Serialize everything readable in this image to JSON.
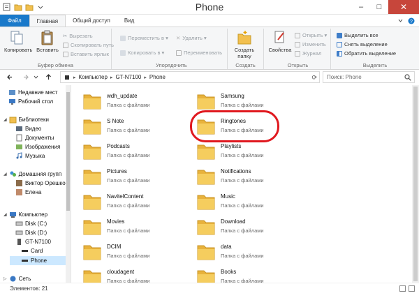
{
  "window": {
    "title": "Phone",
    "controls": {
      "minimize": "–",
      "maximize": "□",
      "close": "✕"
    }
  },
  "ribbon_tabs": [
    {
      "label": "Файл"
    },
    {
      "label": "Главная"
    },
    {
      "label": "Общий доступ"
    },
    {
      "label": "Вид"
    }
  ],
  "ribbon": {
    "clipboard": {
      "group_label": "Буфер обмена",
      "copy": "Копировать",
      "paste": "Вставить",
      "cut": "Вырезать",
      "copy_path": "Скопировать путь",
      "paste_shortcut": "Вставить ярлык"
    },
    "organize": {
      "group_label": "Упорядочить",
      "move_to": "Переместить в ▾",
      "copy_to": "Копировать в ▾",
      "delete": "Удалить ▾",
      "rename": "Переименовать"
    },
    "new": {
      "group_label": "Создать",
      "new_folder_line1": "Создать",
      "new_folder_line2": "папку"
    },
    "open": {
      "group_label": "Открыть",
      "properties": "Свойства",
      "open": "Открыть ▾",
      "edit": "Изменить",
      "history": "Журнал"
    },
    "select": {
      "group_label": "Выделить",
      "select_all": "Выделить все",
      "select_none": "Снять выделение",
      "invert": "Обратить выделение"
    }
  },
  "address": {
    "crumbs": [
      "Компьютер",
      "GT-N7100",
      "Phone"
    ],
    "search_placeholder": "Поиск: Phone"
  },
  "nav": {
    "items": [
      {
        "label": "Недавние мест",
        "icon": "recent-places-icon"
      },
      {
        "label": "Рабочий стол",
        "icon": "desktop-icon"
      },
      {
        "label": "Библиотеки",
        "icon": "libraries-icon"
      },
      {
        "label": "Видео",
        "icon": "video-icon"
      },
      {
        "label": "Документы",
        "icon": "documents-icon"
      },
      {
        "label": "Изображения",
        "icon": "pictures-icon"
      },
      {
        "label": "Музыка",
        "icon": "music-icon"
      },
      {
        "label": "Домашняя групп",
        "icon": "homegroup-icon"
      },
      {
        "label": "Виктор Орешко",
        "icon": "user-icon"
      },
      {
        "label": "Елена",
        "icon": "user-icon"
      },
      {
        "label": "Компьютер",
        "icon": "computer-icon"
      },
      {
        "label": "Disk (C:)",
        "icon": "drive-icon"
      },
      {
        "label": "Disk (D:)",
        "icon": "drive-icon"
      },
      {
        "label": "GT-N7100",
        "icon": "phone-icon"
      },
      {
        "label": "Card",
        "icon": "card-icon"
      },
      {
        "label": "Phone",
        "icon": "phone-storage-icon"
      },
      {
        "label": "Сеть",
        "icon": "network-icon"
      }
    ]
  },
  "folders": [
    {
      "name": "wdh_update",
      "type": "Папка с файлами"
    },
    {
      "name": "Samsung",
      "type": "Папка с файлами"
    },
    {
      "name": "S Note",
      "type": "Папка с файлами"
    },
    {
      "name": "Ringtones",
      "type": "Папка с файлами"
    },
    {
      "name": "Podcasts",
      "type": "Папка с файлами"
    },
    {
      "name": "Playlists",
      "type": "Папка с файлами"
    },
    {
      "name": "Pictures",
      "type": "Папка с файлами"
    },
    {
      "name": "Notifications",
      "type": "Папка с файлами"
    },
    {
      "name": "NavitelContent",
      "type": "Папка с файлами"
    },
    {
      "name": "Music",
      "type": "Папка с файлами"
    },
    {
      "name": "Movies",
      "type": "Папка с файлами"
    },
    {
      "name": "Download",
      "type": "Папка с файлами"
    },
    {
      "name": "DCIM",
      "type": "Папка с файлами"
    },
    {
      "name": "data",
      "type": "Папка с файлами"
    },
    {
      "name": "cloudagent",
      "type": "Папка с файлами"
    },
    {
      "name": "Books",
      "type": "Папка с файлами"
    }
  ],
  "status": {
    "item_count": "Элементов: 21"
  },
  "colors": {
    "file_tab": "#1979ca",
    "selection": "#cce8ff",
    "highlight_ring": "#e0191f",
    "close_button": "#c7463b",
    "folder": "#f2c04f"
  }
}
